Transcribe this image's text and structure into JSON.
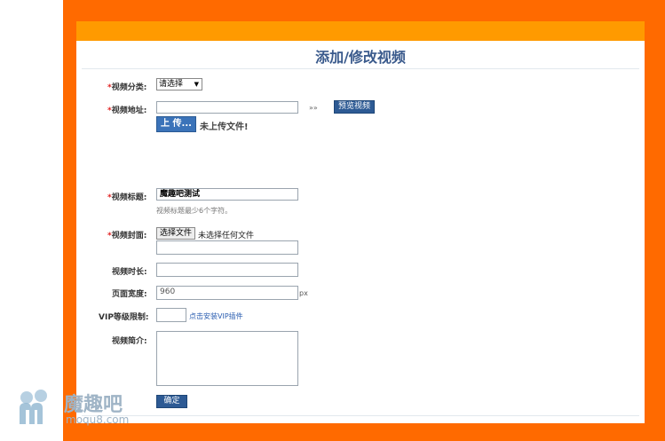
{
  "page": {
    "title": "添加/修改视频"
  },
  "form": {
    "category": {
      "label": "视频分类:",
      "value": "请选择"
    },
    "url": {
      "label": "视频地址:",
      "value": "",
      "arrows": "»»",
      "preview_button": "预览视频",
      "upload_button": "上 传...",
      "upload_status": "未上传文件!"
    },
    "video_title": {
      "label": "视频标题:",
      "value": "魔趣吧测试",
      "hint": "视频标题最少6个字符。"
    },
    "cover": {
      "label": "视频封面:",
      "choose_button": "选择文件",
      "no_file_text": "未选择任何文件",
      "value": ""
    },
    "duration": {
      "label": "视频时长:",
      "value": ""
    },
    "page_width": {
      "label": "页面宽度:",
      "value": "960",
      "unit": "px"
    },
    "vip": {
      "label": "VIP等级限制:",
      "value": "",
      "link": "点击安装VIP插件"
    },
    "intro": {
      "label": "视频简介:",
      "value": ""
    },
    "submit_button": "确定",
    "required_mark": "*"
  },
  "watermark": {
    "brand": "魔趣吧",
    "domain": "moqu8.com"
  },
  "colors": {
    "frame": "#ff6a00",
    "header_bar": "#ff9a00",
    "title": "#3a5a8c",
    "button": "#2d5a94",
    "required": "#e02020"
  }
}
